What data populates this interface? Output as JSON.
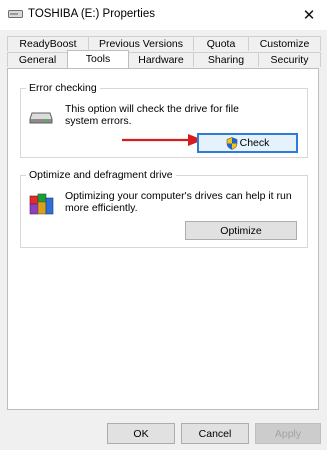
{
  "window": {
    "title": "TOSHIBA (E:) Properties",
    "close_glyph": "✕"
  },
  "tabs_row1": [
    "ReadyBoost",
    "Previous Versions",
    "Quota",
    "Customize"
  ],
  "tabs_row2": [
    "General",
    "Tools",
    "Hardware",
    "Sharing",
    "Security"
  ],
  "active_tab": "Tools",
  "error_checking": {
    "title": "Error checking",
    "description_line1": "This option will check the drive for file",
    "description_line2": "system errors.",
    "button_label": "Check",
    "icon": "drive-icon",
    "button_icon": "uac-shield-icon"
  },
  "optimize": {
    "title": "Optimize and defragment drive",
    "description_line1": "Optimizing your computer's drives can help it run",
    "description_line2": "more efficiently.",
    "button_label": "Optimize",
    "icon": "defrag-icon"
  },
  "footer": {
    "ok": "OK",
    "cancel": "Cancel",
    "apply": "Apply"
  },
  "colors": {
    "arrow": "#d81b1b",
    "focus_border": "#2d7cd6"
  }
}
